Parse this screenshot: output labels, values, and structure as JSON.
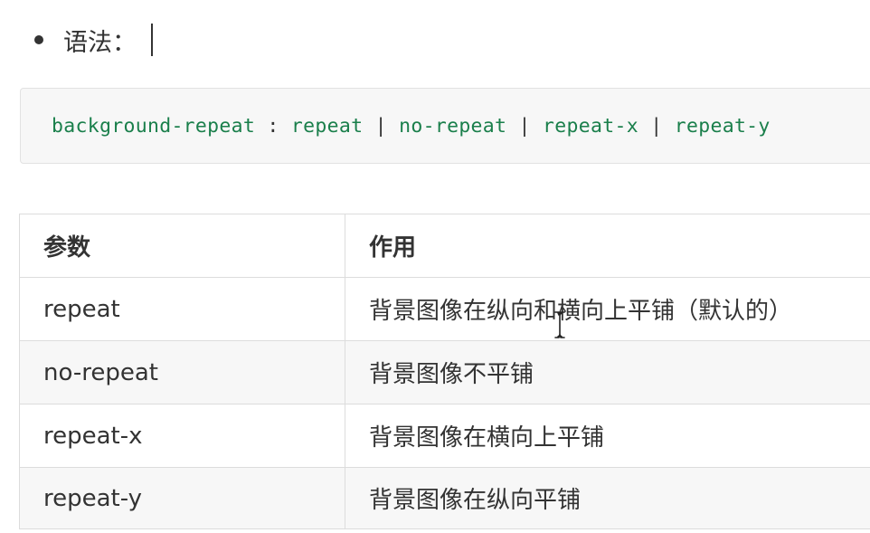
{
  "syntax": {
    "label": "语法："
  },
  "code": {
    "property": "background-repeat",
    "colon": " : ",
    "separator": " | ",
    "values": [
      "repeat",
      "no-repeat",
      "repeat-x",
      "repeat-y"
    ]
  },
  "table": {
    "headers": [
      "参数",
      "作用"
    ],
    "rows": [
      {
        "param": "repeat",
        "effect": "背景图像在纵向和横向上平铺（默认的）"
      },
      {
        "param": "no-repeat",
        "effect": "背景图像不平铺"
      },
      {
        "param": "repeat-x",
        "effect": "背景图像在横向上平铺"
      },
      {
        "param": "repeat-y",
        "effect": "背景图像在纵向平铺"
      }
    ]
  },
  "colors": {
    "code_green": "#1a7f4b",
    "text": "#333333",
    "row_shade": "#f7f7f7",
    "border": "#dcdcdc"
  },
  "icons": {
    "bullet": "bullet-dot",
    "mouse_cursor": "ibeam-cursor-icon"
  }
}
